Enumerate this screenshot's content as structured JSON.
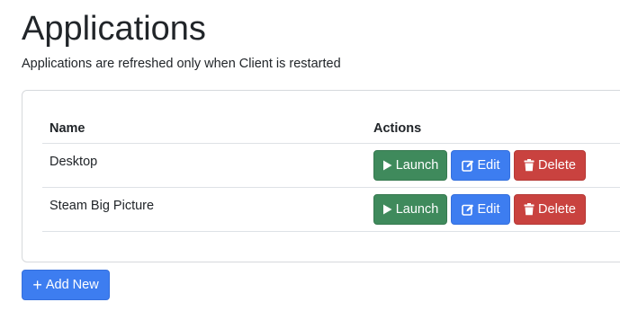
{
  "header": {
    "title": "Applications",
    "subtitle": "Applications are refreshed only when Client is restarted"
  },
  "table": {
    "columns": [
      "Name",
      "Actions"
    ],
    "rows": [
      {
        "name": "Desktop",
        "launch": "Launch",
        "edit": "Edit",
        "delete": "Delete"
      },
      {
        "name": "Steam Big Picture",
        "launch": "Launch",
        "edit": "Edit",
        "delete": "Delete"
      }
    ]
  },
  "footer": {
    "add_label": "Add New"
  },
  "icons": {
    "launch": "play-icon",
    "edit": "edit-icon",
    "delete": "trash-icon",
    "add": "plus-icon"
  },
  "colors": {
    "launch": "#3f8a5c",
    "edit": "#3d7df0",
    "delete": "#c9423f",
    "add": "#3d7df0"
  }
}
